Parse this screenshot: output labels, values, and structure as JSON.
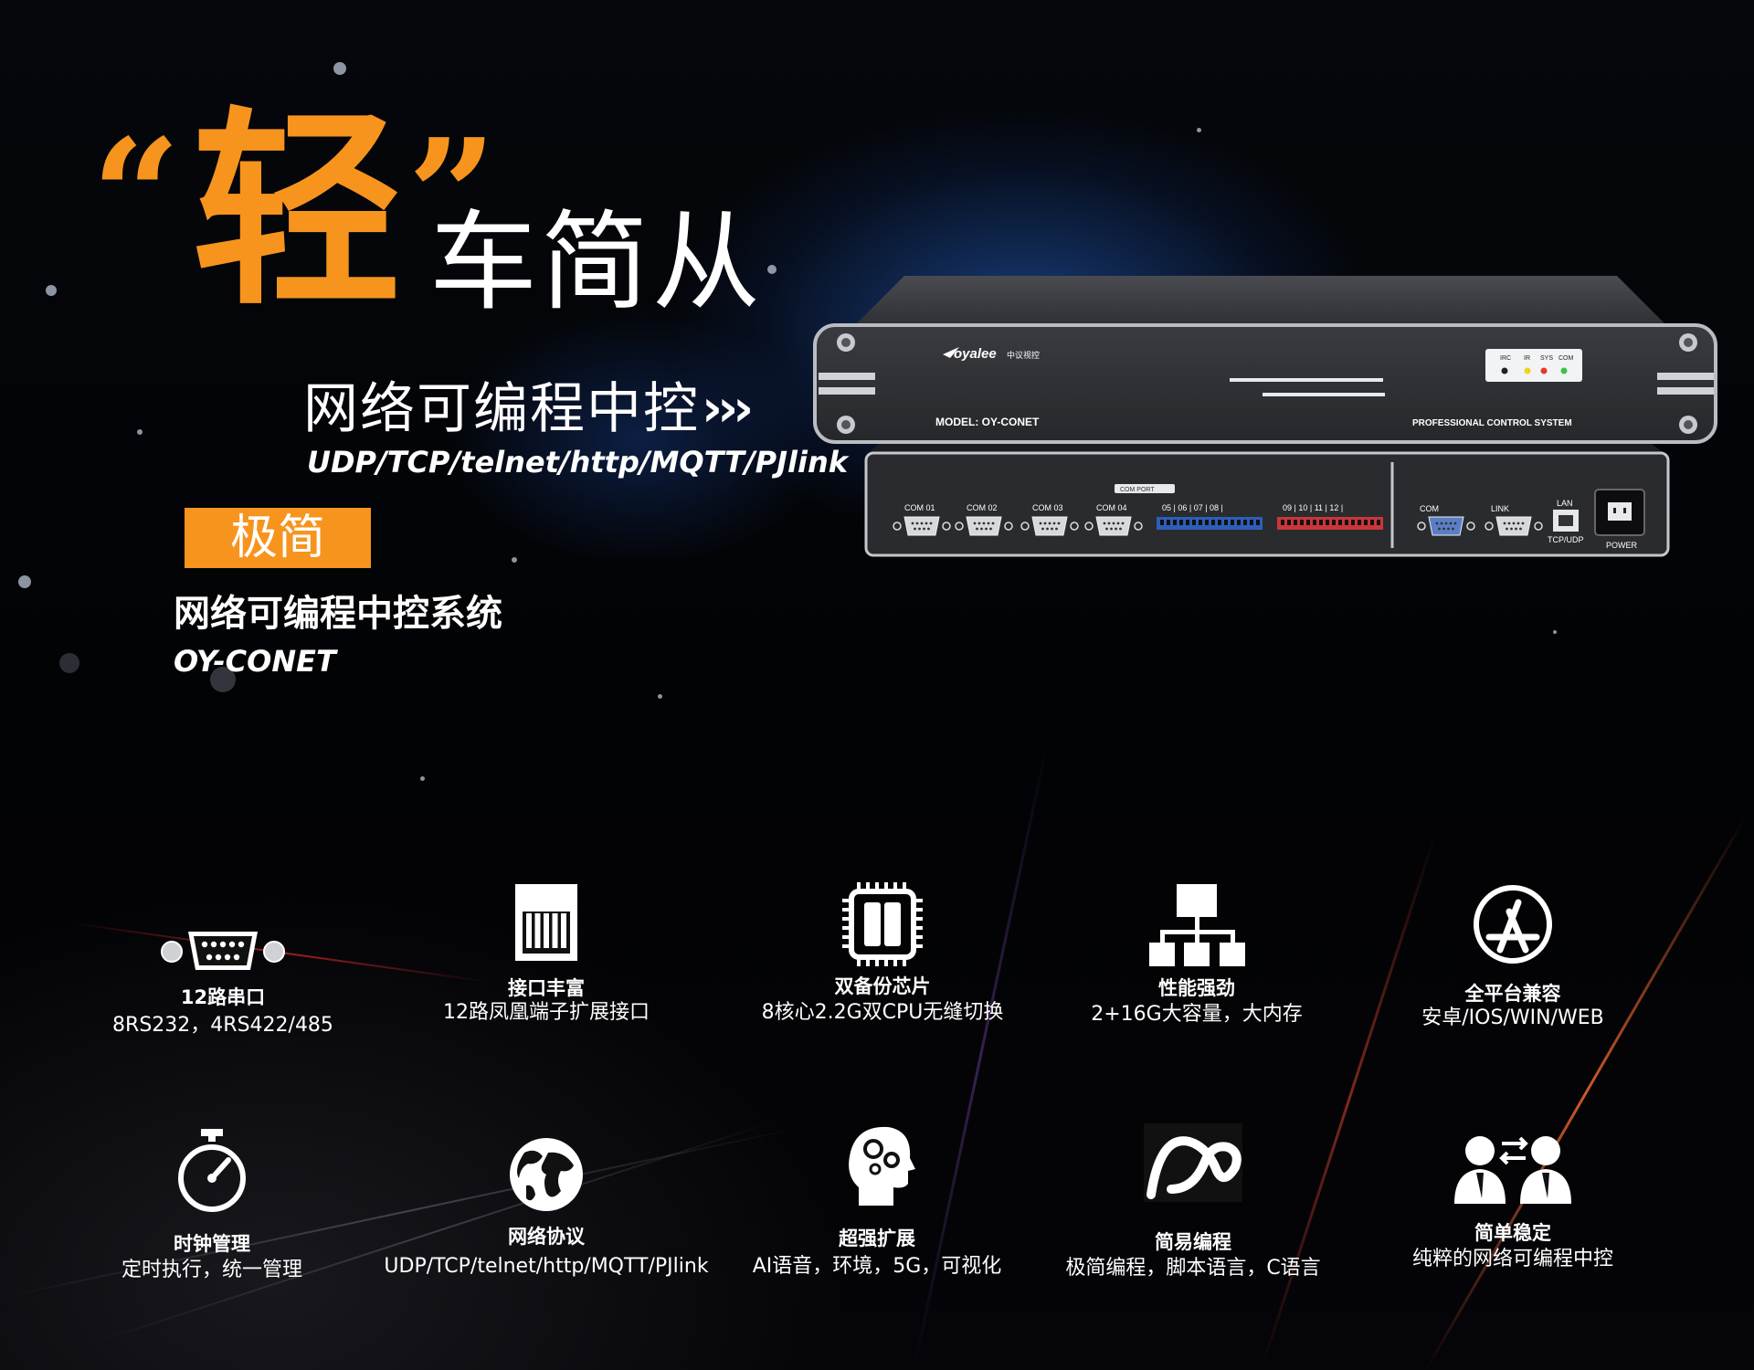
{
  "headline": {
    "open_quote": "“",
    "big_char": "轻",
    "close_quote": "”",
    "rest": "车简从"
  },
  "subtitle": "网络可编程中控",
  "arrows": "›››",
  "protocols": "UDP/TCP/telnet/http/MQTT/PJlink",
  "badge": "极简",
  "product_name": "网络可编程中控系统",
  "model_name": "OY-CONET",
  "device": {
    "brand": "oyalee",
    "brand_cn": "中议视控",
    "model_label": "MODEL:  OY-CONET",
    "system_label": "PROFESSIONAL CONTROL SYSTEM",
    "leds": [
      "IRC",
      "IR",
      "SYS",
      "COM"
    ],
    "com_ports": [
      "COM 01",
      "COM 02",
      "COM 03",
      "COM 04"
    ],
    "com_port_tag": "COM PORT",
    "phoenix_labels_a": "05  |  06  |  07  |  08  |",
    "phoenix_labels_b": "09  |  10  |  11  |  12  |",
    "com_label": "COM",
    "link_label": "LINK",
    "lan_label": "LAN",
    "tcp_label": "TCP/UDP",
    "power_label": "POWER"
  },
  "colors": {
    "accent": "#f7941d",
    "background": "#000000"
  },
  "features": [
    {
      "icon": "serial-port-icon",
      "title": "12路串口",
      "desc": "8RS232，4RS422/485"
    },
    {
      "icon": "terminal-block-icon",
      "title": "接口丰富",
      "desc": "12路凤凰端子扩展接口"
    },
    {
      "icon": "chip-icon",
      "title": "双备份芯片",
      "desc": "8核心2.2G双CPU无缝切换"
    },
    {
      "icon": "hierarchy-icon",
      "title": "性能强劲",
      "desc": "2+16G大容量，大内存"
    },
    {
      "icon": "app-store-icon",
      "title": "全平台兼容",
      "desc": "安卓/IOS/WIN/WEB"
    },
    {
      "icon": "stopwatch-icon",
      "title": "时钟管理",
      "desc": "定时执行，统一管理"
    },
    {
      "icon": "globe-icon",
      "title": "网络协议",
      "desc": "UDP/TCP/telnet/http/MQTT/PJlink"
    },
    {
      "icon": "brain-gears-icon",
      "title": "超强扩展",
      "desc": "AI语音，环境，5G，可视化"
    },
    {
      "icon": "infinity-icon",
      "title": "简易编程",
      "desc": "极简编程，脚本语言，C语言"
    },
    {
      "icon": "users-exchange-icon",
      "title": "简单稳定",
      "desc": "纯粹的网络可编程中控"
    }
  ]
}
